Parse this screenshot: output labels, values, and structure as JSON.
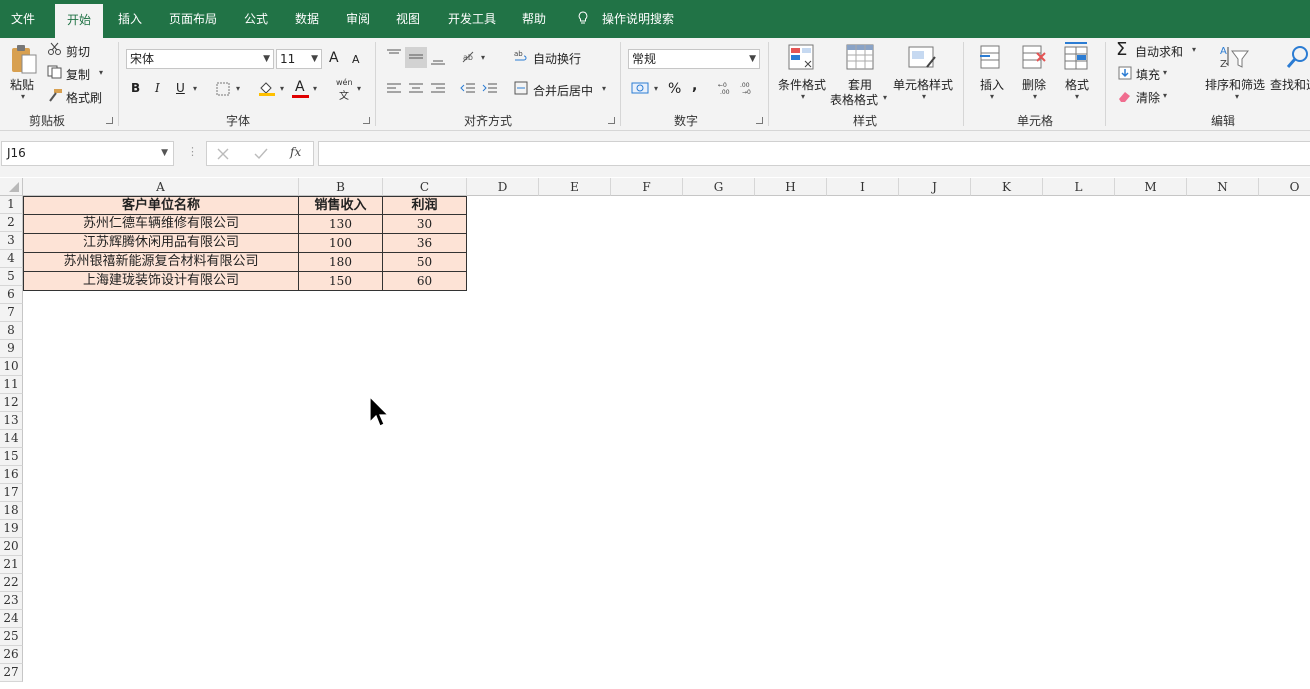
{
  "tabs": [
    "文件",
    "开始",
    "插入",
    "页面布局",
    "公式",
    "数据",
    "审阅",
    "视图",
    "开发工具",
    "帮助"
  ],
  "tell_me": "操作说明搜索",
  "ribbon": {
    "clipboard": {
      "paste": "粘贴",
      "cut": "剪切",
      "copy": "复制",
      "format_painter": "格式刷",
      "group": "剪贴板"
    },
    "font": {
      "name": "宋体",
      "size": "11",
      "bold": "B",
      "italic": "I",
      "underline": "U",
      "grow": "A",
      "shrink": "A",
      "phonetic_top": "wén",
      "phonetic_bottom": "文",
      "font_color_glyph": "A",
      "group": "字体"
    },
    "alignment": {
      "wrap_text": "自动换行",
      "merge_center": "合并后居中",
      "group": "对齐方式"
    },
    "number": {
      "format": "常规",
      "percent": "%",
      "comma": ",",
      "group": "数字"
    },
    "styles": {
      "conditional": "条件格式",
      "as_table_1": "套用",
      "as_table_2": "表格格式",
      "cell_styles": "单元格样式",
      "group": "样式"
    },
    "cells": {
      "insert": "插入",
      "delete": "删除",
      "format": "格式",
      "group": "单元格"
    },
    "editing": {
      "autosum": "自动求和",
      "fill": "填充",
      "clear": "清除",
      "sort_filter": "排序和筛选",
      "find_select": "查找和选",
      "group": "编辑"
    }
  },
  "formula_bar": {
    "name_box": "J16",
    "fx": "fx",
    "formula": ""
  },
  "columns": [
    "A",
    "B",
    "C",
    "D",
    "E",
    "F",
    "G",
    "H",
    "I",
    "J",
    "K",
    "L",
    "M",
    "N",
    "O"
  ],
  "rows": [
    "1",
    "2",
    "3",
    "4",
    "5",
    "6",
    "7",
    "8",
    "9",
    "10",
    "11",
    "12",
    "13",
    "14",
    "15",
    "16",
    "17",
    "18",
    "19",
    "20",
    "21",
    "22",
    "23",
    "24",
    "25",
    "26",
    "27"
  ],
  "table": {
    "headers": [
      "客户单位名称",
      "销售收入",
      "利润"
    ],
    "rows": [
      [
        "苏州仁德车辆维修有限公司",
        "130",
        "30"
      ],
      [
        "江苏辉腾休闲用品有限公司",
        "100",
        "36"
      ],
      [
        "苏州银禧新能源复合材料有限公司",
        "180",
        "50"
      ],
      [
        "上海建珑装饰设计有限公司",
        "150",
        "60"
      ]
    ]
  },
  "colors": {
    "brand": "#217346",
    "table_fill": "#fde3d6",
    "ribbon_bg": "#f3f3f3"
  }
}
